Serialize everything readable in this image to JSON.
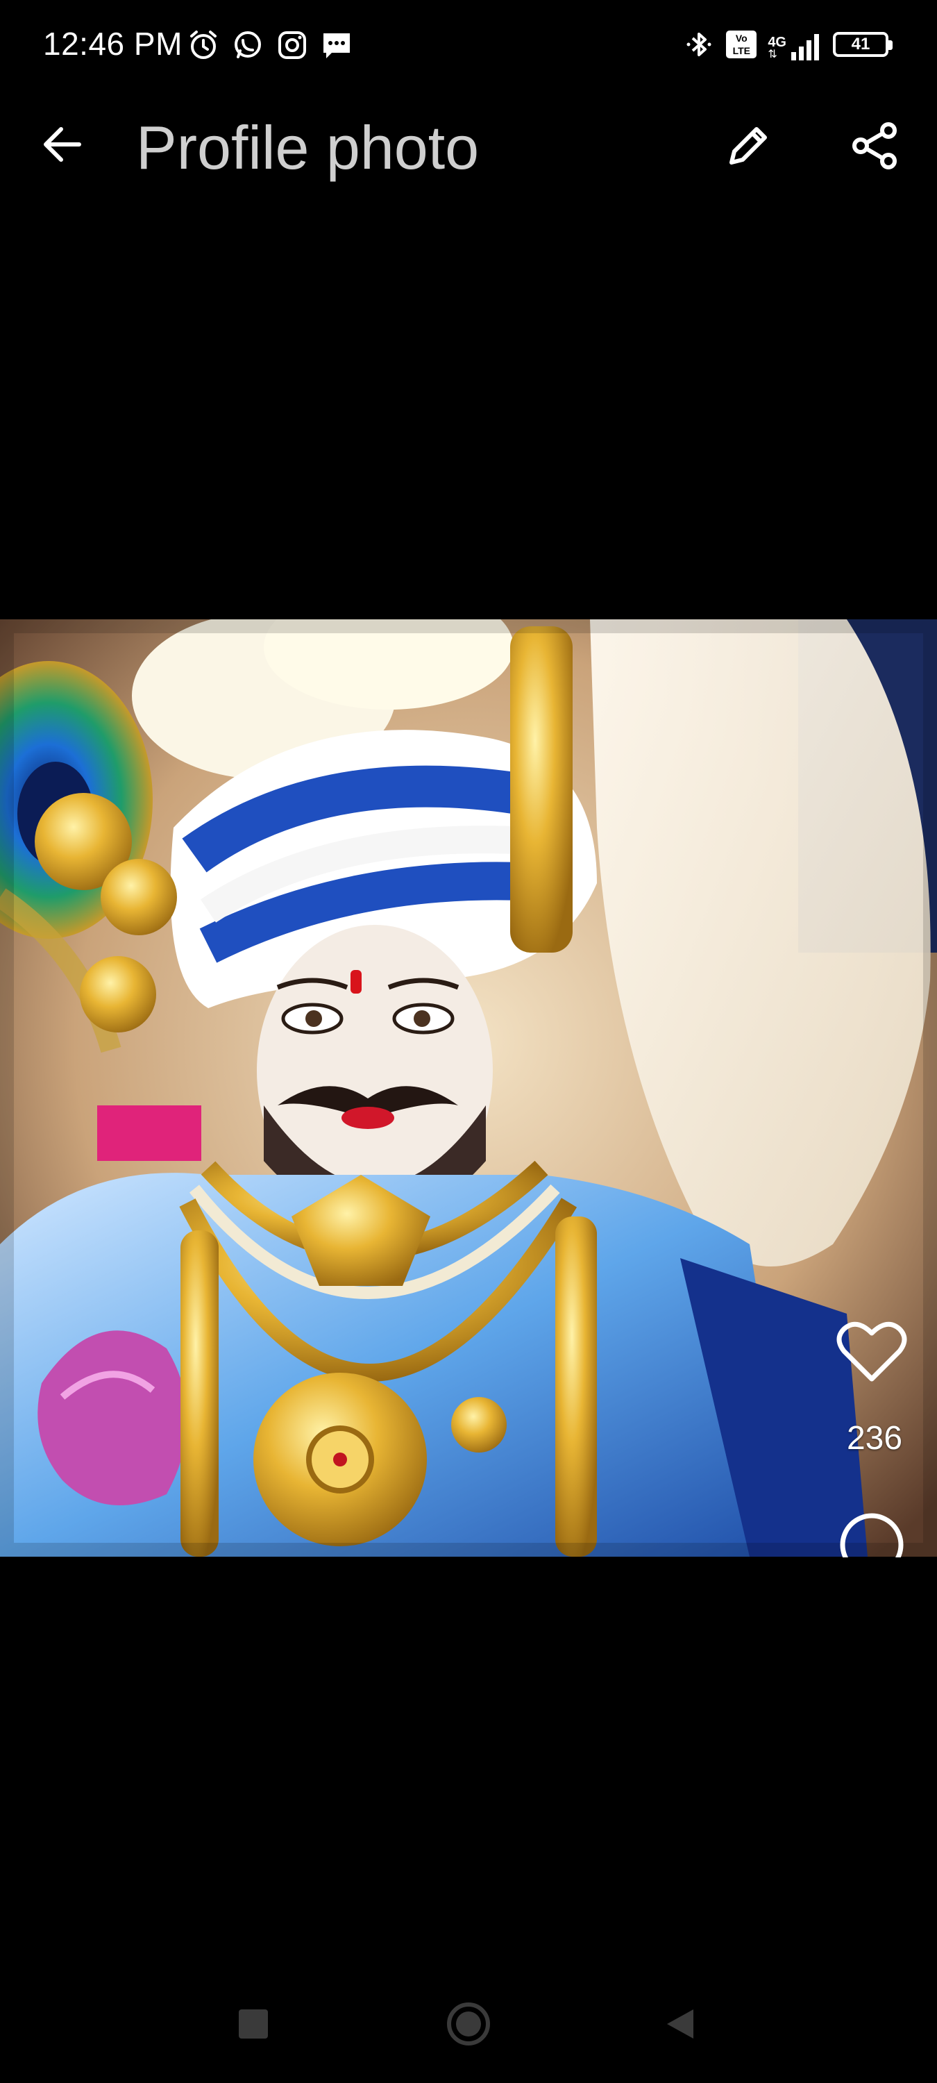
{
  "status_bar": {
    "time": "12:46 PM",
    "left_icons": [
      "alarm-icon",
      "whatsapp-icon",
      "instagram-icon",
      "message-icon"
    ],
    "right_icons": [
      "bluetooth-icon",
      "volte-icon",
      "signal-4g-icon"
    ],
    "network": "4G",
    "volte": "Vo LTE",
    "battery": "41"
  },
  "app_bar": {
    "title": "Profile photo",
    "back_icon": "arrow-left-icon",
    "edit_icon": "pencil-icon",
    "share_icon": "share-icon"
  },
  "photo": {
    "likes": "236",
    "like_icon": "heart-outline-icon",
    "comment_icon": "comment-bubble-icon"
  },
  "nav_bar": {
    "icons": [
      "recents-square-icon",
      "home-circle-icon",
      "back-triangle-icon"
    ]
  },
  "colors": {
    "background": "#000000",
    "title": "#cfcfcf",
    "icon": "#ffffff",
    "nav_icon": "#3a3a3a"
  }
}
